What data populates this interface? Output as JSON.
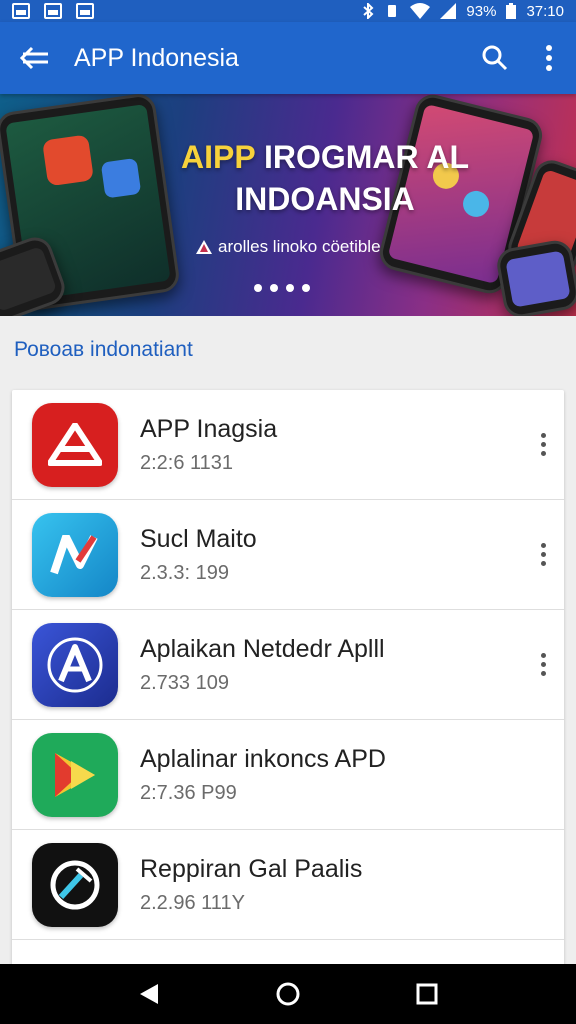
{
  "status_bar": {
    "battery_text": "93%",
    "time": "37:10"
  },
  "app_bar": {
    "title": "APP Indonesia",
    "back_icon": "arrow-back-icon",
    "search_icon": "search-icon",
    "menu_icon": "more-vert-icon"
  },
  "banner": {
    "headline_highlight": "AIPP",
    "headline_rest": " IROGMAR AL",
    "headline_line2": "INDOANSIA",
    "subtitle": "arolles linoko cöetible",
    "page_count": 4
  },
  "section": {
    "title": "Ровоав indonatiant"
  },
  "apps": [
    {
      "name": "APP Inagsia",
      "meta": "2:2:6 1131",
      "icon": "app-red-icon",
      "color": "#d71f1f"
    },
    {
      "name": "Sucl Maito",
      "meta": "2.3.3: 199",
      "icon": "app-n-icon",
      "color": "#1ea6dc"
    },
    {
      "name": "Aplaikan Netdedr Aplll",
      "meta": "2.733 109",
      "icon": "app-a-icon",
      "color": "#2b3fb5"
    },
    {
      "name": "Aplalinar inkoncs APD",
      "meta": "2:7.36 P99",
      "icon": "app-play-icon",
      "color": "#1faa5a"
    },
    {
      "name": "Reppiran Gal Paalis",
      "meta": "2.2.96 111Y",
      "icon": "app-circle-icon",
      "color": "#111111"
    }
  ],
  "colors": {
    "primary": "#2066cc",
    "status": "#1f5fbf",
    "accent_yellow": "#f7d23b"
  }
}
